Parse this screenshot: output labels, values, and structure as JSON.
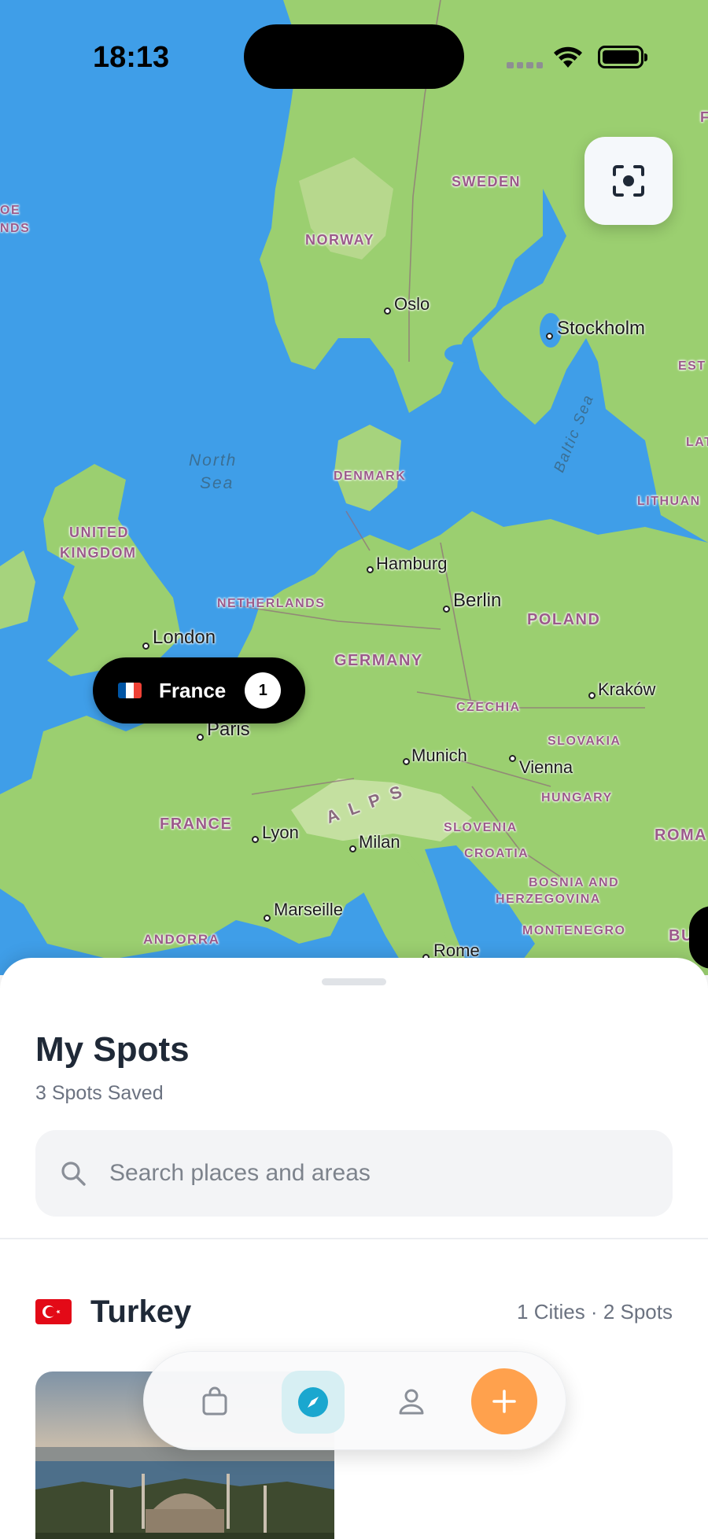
{
  "status_bar": {
    "time": "18:13"
  },
  "map": {
    "focus_button_icon": "focus-scan-icon",
    "countries": {
      "sweden": "SWEDEN",
      "norway": "NORWAY",
      "denmark": "DENMARK",
      "united_kingdom_1": "UNITED",
      "united_kingdom_2": "KINGDOM",
      "netherlands": "NETHERLANDS",
      "germany": "GERMANY",
      "poland": "POLAND",
      "czechia": "CZECHIA",
      "slovakia": "SLOVAKIA",
      "hungary": "HUNGARY",
      "slovenia": "SLOVENIA",
      "croatia": "CROATIA",
      "bosnia_1": "BOSNIA AND",
      "bosnia_2": "HERZEGOVINA",
      "montenegro": "MONTENEGRO",
      "france": "FRANCE",
      "andorra": "ANDORRA",
      "lithuania": "LITHUAN",
      "latvia": "LAT",
      "estonia": "EST",
      "romania": "ROMA",
      "bulgaria": "BU",
      "faroe_1": "OE",
      "faroe_2": "NDS",
      "finland": "F"
    },
    "cities": {
      "oslo": "Oslo",
      "stockholm": "Stockholm",
      "hamburg": "Hamburg",
      "berlin": "Berlin",
      "london": "London",
      "paris": "Paris",
      "munich": "Munich",
      "vienna": "Vienna",
      "krakow": "Kraków",
      "lyon": "Lyon",
      "milan": "Milan",
      "marseille": "Marseille",
      "rome": "Rome"
    },
    "water": {
      "north_sea_1": "North",
      "north_sea_2": "Sea",
      "baltic_sea": "Baltic Sea",
      "alps": "ALPS"
    },
    "country_pill": {
      "label": "France",
      "count": "1",
      "flag": "france-flag"
    }
  },
  "sheet": {
    "title": "My Spots",
    "subtitle": "3 Spots Saved",
    "search_placeholder": "Search places and areas",
    "groups": [
      {
        "name": "Turkey",
        "flag": "turkey-flag",
        "meta": "1 Cities · 2 Spots"
      }
    ]
  },
  "tab_bar": {
    "items": [
      {
        "name": "bag",
        "icon": "shopping-bag-icon"
      },
      {
        "name": "explore",
        "icon": "compass-icon",
        "active": true
      },
      {
        "name": "profile",
        "icon": "person-icon"
      },
      {
        "name": "add",
        "icon": "plus-icon"
      }
    ],
    "colors": {
      "active_bg": "#d7eff3",
      "active_icon": "#1aa7cf",
      "add_bg": "#ffa14d"
    }
  }
}
